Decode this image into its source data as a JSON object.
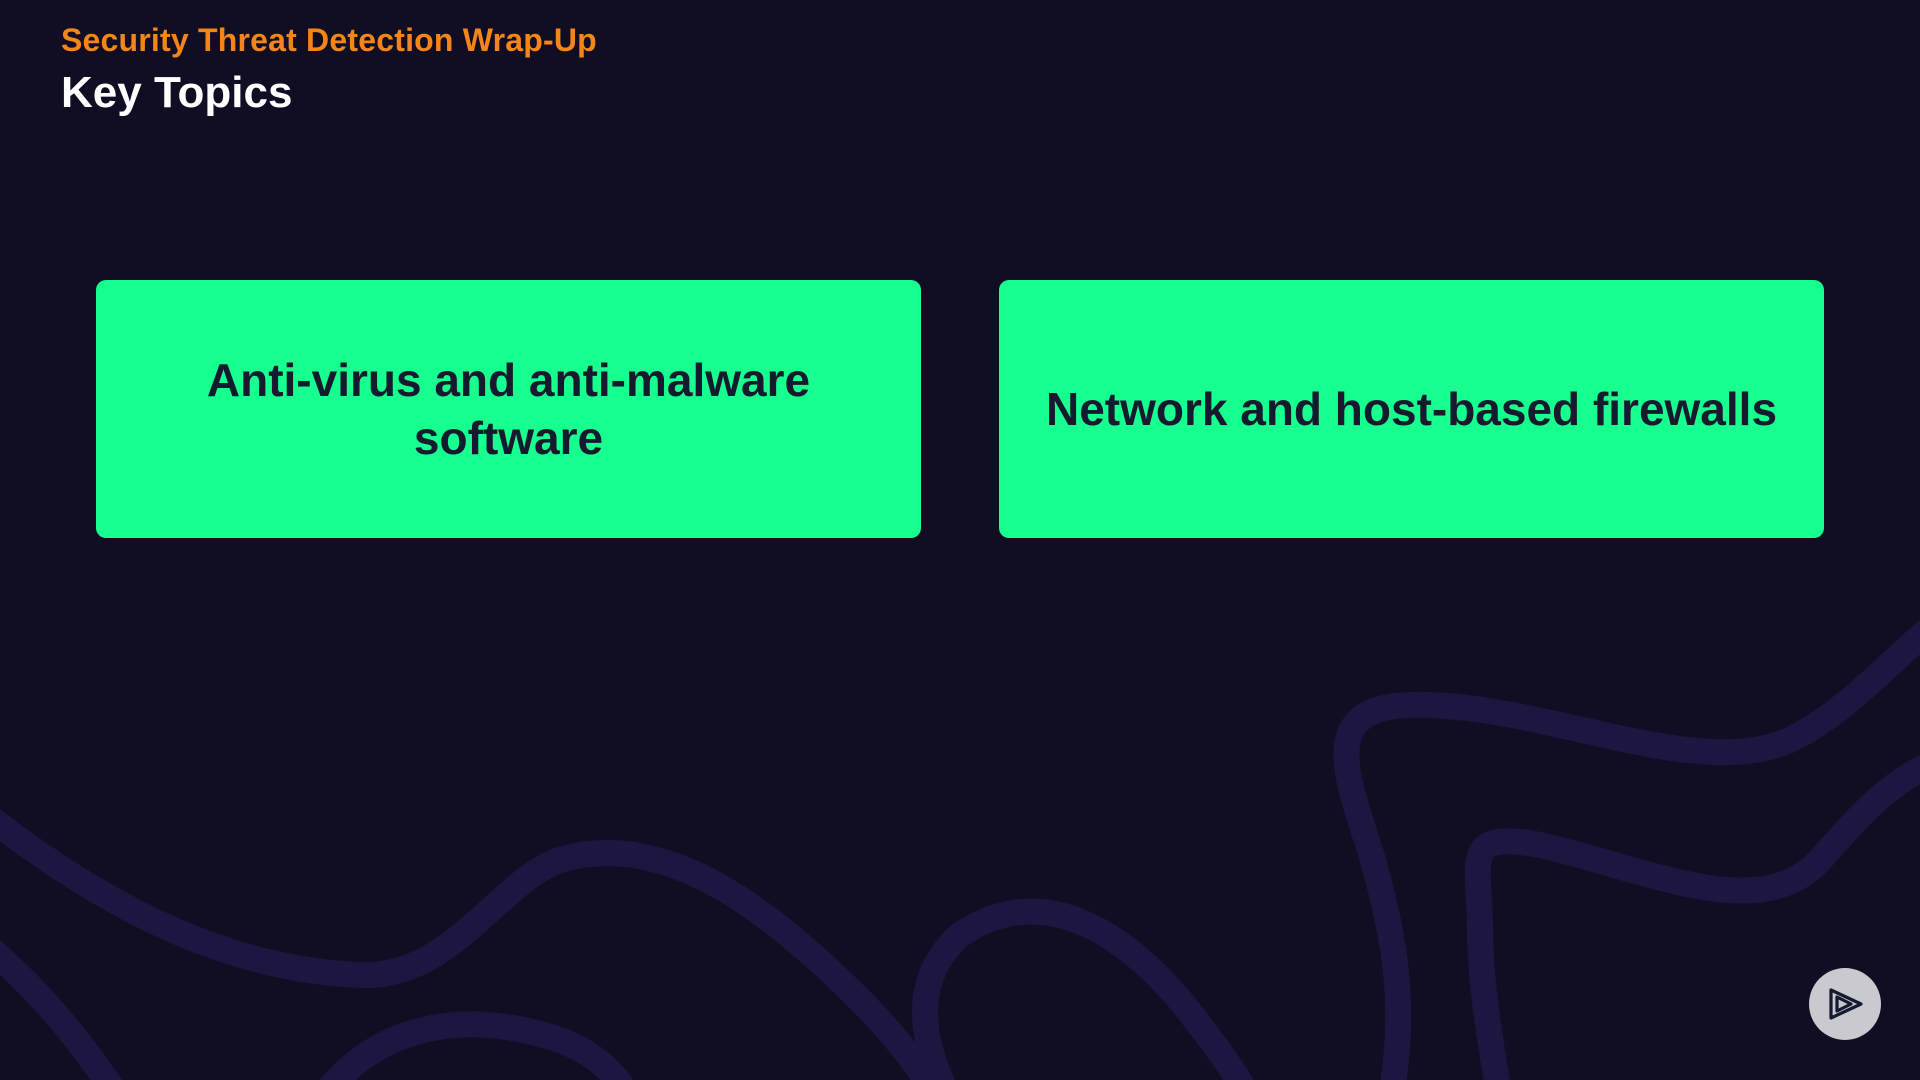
{
  "header": {
    "subtitle": "Security Threat Detection Wrap-Up",
    "title": "Key Topics"
  },
  "cards": [
    {
      "label": "Anti-virus and anti-malware software"
    },
    {
      "label": "Network and host-based firewalls"
    }
  ],
  "player": {
    "icon": "play-icon"
  },
  "colors": {
    "background": "#110e24",
    "accent_orange": "#f38519",
    "card_green": "#17ff8f",
    "card_text": "#151a2e",
    "wave_line": "#1d1740"
  }
}
